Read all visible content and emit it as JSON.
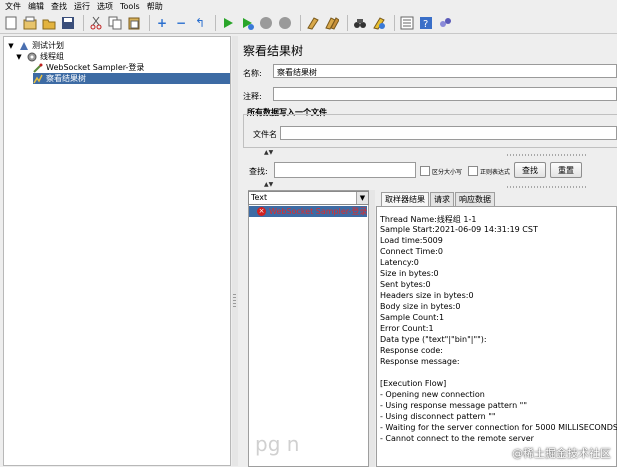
{
  "menu": [
    "文件",
    "编辑",
    "查找",
    "运行",
    "选项",
    "Tools",
    "帮助"
  ],
  "toolbar_icons": [
    "new-icon",
    "templates-icon",
    "open-icon",
    "save-icon",
    "cut-icon",
    "copy-icon",
    "paste-icon",
    "expand-icon",
    "collapse-icon",
    "toggle-icon",
    "start-icon",
    "start-no-pause-icon",
    "stop-icon",
    "shutdown-icon",
    "clear-icon",
    "clear-all-icon",
    "search-icon",
    "reset-search-icon",
    "function-helper-icon",
    "help-icon",
    "remote-icon"
  ],
  "tree": {
    "items": [
      {
        "label": "测试计划",
        "icon": "test-plan-icon"
      },
      {
        "label": "线程组",
        "icon": "thread-group-icon"
      },
      {
        "label": "WebSocket Sampler-登录",
        "icon": "sampler-icon"
      },
      {
        "label": "察看结果树",
        "icon": "listener-icon"
      }
    ]
  },
  "panel": {
    "title": "察看结果树",
    "name_label": "名称:",
    "name_value": "察看结果树",
    "comment_label": "注释:",
    "comment_value": "",
    "write_all_label": "所有数据写入一个文件",
    "filename_label": "文件名",
    "filename_value": "",
    "search_label": "查找:",
    "search_value": "",
    "case_sensitive_label": "区分大小写",
    "regex_label": "正则表达式",
    "find_button": "查找",
    "reset_button": "重置"
  },
  "results": {
    "renderer": "Text",
    "sampler_label": "WebSocket Sampler-登录",
    "tabs": [
      "取样器结果",
      "请求",
      "响应数据"
    ],
    "lines": [
      "Thread Name:线程组 1-1",
      "Sample Start:2021-06-09 14:31:19 CST",
      "Load time:5009",
      "Connect Time:0",
      "Latency:0",
      "Size in bytes:0",
      "Sent bytes:0",
      "Headers size in bytes:0",
      "Body size in bytes:0",
      "Sample Count:1",
      "Error Count:1",
      "Data type (\"text\"|\"bin\"|\"\"):",
      "Response code:",
      "Response message:",
      "",
      "[Execution Flow]",
      " - Opening new connection",
      " - Using response message pattern \"\"",
      " - Using disconnect pattern \"\"",
      " - Waiting for the server connection for 5000 MILLISECONDS",
      " - Cannot connect to the remote server"
    ]
  },
  "watermark": "@稀土掘金技术社区",
  "ghost_text": "pg           n"
}
